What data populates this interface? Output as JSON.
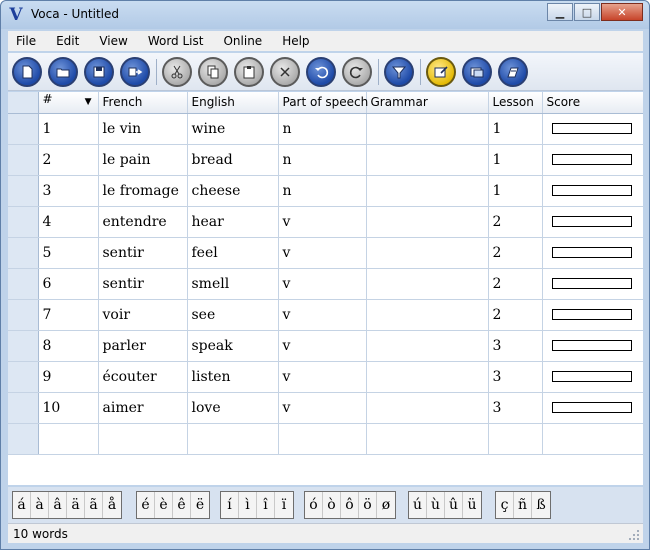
{
  "window": {
    "title": "Voca - Untitled",
    "logo": "V",
    "controls": {
      "minimize": "▁",
      "maximize": "□",
      "close": "✕"
    }
  },
  "menu": [
    "File",
    "Edit",
    "View",
    "Word List",
    "Online",
    "Help"
  ],
  "toolbar": [
    {
      "icon": "new-document-icon"
    },
    {
      "icon": "open-folder-icon"
    },
    {
      "icon": "save-disk-icon"
    },
    {
      "icon": "export-icon"
    },
    {
      "icon": "cut-scissors-icon"
    },
    {
      "icon": "copy-icon"
    },
    {
      "icon": "paste-clipboard-icon"
    },
    {
      "icon": "delete-x-icon"
    },
    {
      "icon": "undo-icon"
    },
    {
      "icon": "redo-icon"
    },
    {
      "icon": "filter-funnel-icon"
    },
    {
      "icon": "edit-note-icon"
    },
    {
      "icon": "flashcards-icon"
    },
    {
      "icon": "quiz-icon"
    }
  ],
  "columns": [
    "#",
    "French",
    "English",
    "Part of speech",
    "Grammar",
    "Lesson",
    "Score"
  ],
  "rows": [
    {
      "num": "1",
      "french": "le vin",
      "english": "wine",
      "pos": "n",
      "grammar": "",
      "lesson": "1",
      "score": 0
    },
    {
      "num": "2",
      "french": "le pain",
      "english": "bread",
      "pos": "n",
      "grammar": "",
      "lesson": "1",
      "score": 0
    },
    {
      "num": "3",
      "french": "le fromage",
      "english": "cheese",
      "pos": "n",
      "grammar": "",
      "lesson": "1",
      "score": 0
    },
    {
      "num": "4",
      "french": "entendre",
      "english": "hear",
      "pos": "v",
      "grammar": "",
      "lesson": "2",
      "score": 0
    },
    {
      "num": "5",
      "french": "sentir",
      "english": "feel",
      "pos": "v",
      "grammar": "",
      "lesson": "2",
      "score": 0
    },
    {
      "num": "6",
      "french": "sentir",
      "english": "smell",
      "pos": "v",
      "grammar": "",
      "lesson": "2",
      "score": 0
    },
    {
      "num": "7",
      "french": "voir",
      "english": "see",
      "pos": "v",
      "grammar": "",
      "lesson": "2",
      "score": 0
    },
    {
      "num": "8",
      "french": "parler",
      "english": "speak",
      "pos": "v",
      "grammar": "",
      "lesson": "3",
      "score": 0
    },
    {
      "num": "9",
      "french": "écouter",
      "english": "listen",
      "pos": "v",
      "grammar": "",
      "lesson": "3",
      "score": 0
    },
    {
      "num": "10",
      "french": "aimer",
      "english": "love",
      "pos": "v",
      "grammar": "",
      "lesson": "3",
      "score": 0
    }
  ],
  "special_chars": [
    [
      "á",
      "à",
      "â",
      "ä",
      "ã",
      "å"
    ],
    [
      "é",
      "è",
      "ê",
      "ë"
    ],
    [
      "í",
      "ì",
      "î",
      "ï"
    ],
    [
      "ó",
      "ò",
      "ô",
      "ö",
      "ø"
    ],
    [
      "ú",
      "ù",
      "û",
      "ü"
    ],
    [
      "ç",
      "ñ",
      "ß"
    ]
  ],
  "status": "10 words"
}
